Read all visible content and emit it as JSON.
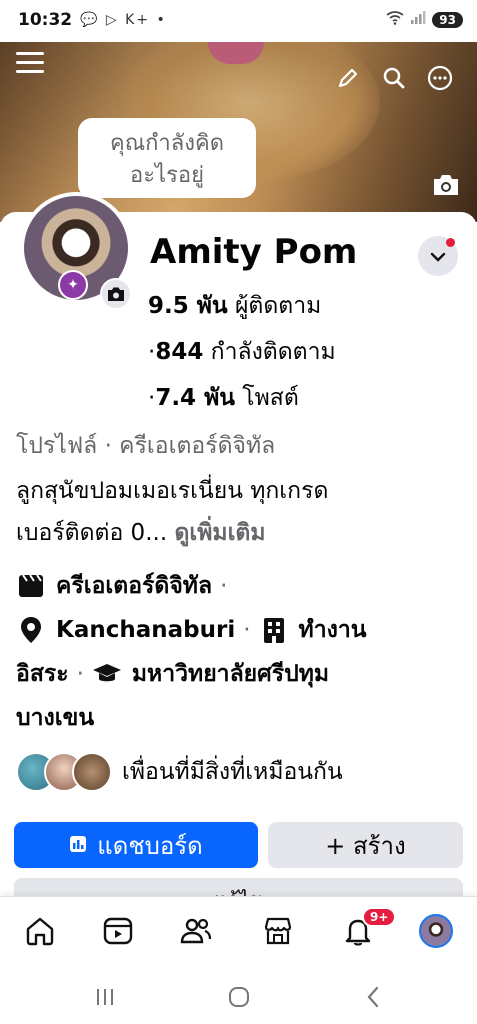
{
  "status_bar": {
    "time": "10:32",
    "notif_icons": "💬 ▷ K+ •",
    "battery": "93"
  },
  "cover": {
    "thought_prompt": "คุณกำลังคิดอะไรอยู่"
  },
  "profile": {
    "name": "Amity Pom",
    "followers_num": "9.5 พัน",
    "followers_label": "ผู้ติดตาม",
    "following_num": "844",
    "following_label": "กำลังติดตาม",
    "posts_num": "7.4 พัน",
    "posts_label": "โพสต์",
    "category": "โปรไฟล์ · ครีเอเตอร์ดิจิทัล",
    "bio_line1": "ลูกสุนัขปอมเมอเรเนี่ยน ทุกเกรด",
    "bio_line2": "เบอร์ติดต่อ 0...",
    "see_more": "ดูเพิ่มเติม"
  },
  "info": {
    "creator": "ครีเอเตอร์ดิจิทัล",
    "location": "Kanchanaburi",
    "work_part1": "ทำงาน",
    "work_part2": "อิสระ",
    "education_part1": "มหาวิทยาลัยศรีปทุม",
    "education_part2": "บางเขน",
    "separator": "·"
  },
  "mutual": {
    "text": "เพื่อนที่มีสิ่งที่เหมือนกัน"
  },
  "buttons": {
    "dashboard": "แดชบอร์ด",
    "create": "+ สร้าง",
    "edit": "แก้ไข"
  },
  "nav": {
    "bell_badge": "9+"
  },
  "colors": {
    "accent": "#0866ff",
    "badge": "#e41e3f",
    "muted": "#65676b",
    "button_gray": "#e4e6eb"
  }
}
